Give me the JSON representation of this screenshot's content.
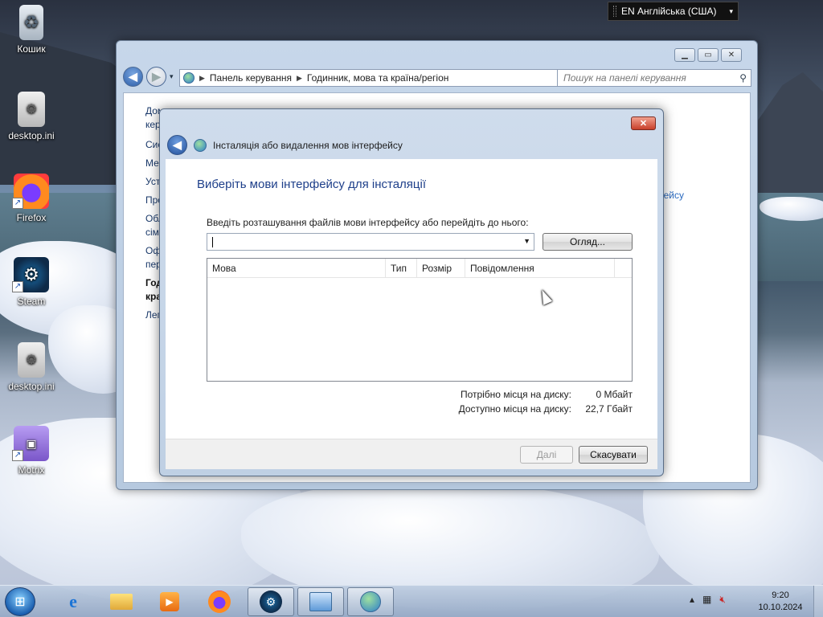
{
  "desktop": {
    "icons": [
      {
        "label": "Кошик",
        "icon": "recycle-bin-icon"
      },
      {
        "label": "desktop.ini",
        "icon": "settings-file-icon"
      },
      {
        "label": "Firefox",
        "icon": "firefox-icon"
      },
      {
        "label": "Steam",
        "icon": "steam-icon"
      },
      {
        "label": "desktop.ini",
        "icon": "settings-file-icon"
      },
      {
        "label": "Motrix",
        "icon": "motrix-icon"
      }
    ]
  },
  "langbar": {
    "label": "EN Англійська (США)"
  },
  "control_panel": {
    "breadcrumb": [
      "Панель керування",
      "Годинник, мова та країна/регіон"
    ],
    "search_placeholder": "Пошук на панелі керування",
    "sidebar_fragments": [
      "Дом",
      "кер",
      "Сис",
      "Мен",
      "Уст",
      "Про",
      "Обл",
      "сім",
      "Оф",
      "пер",
      "Год",
      "кра",
      "Лег"
    ],
    "right_fragment": "фейсу"
  },
  "dialog": {
    "window_title": "Інсталяція або видалення мов інтерфейсу",
    "heading": "Виберіть мови інтерфейсу для інсталяції",
    "location_prompt": "Введіть розташування файлів мови інтерфейсу або перейдіть до нього:",
    "location_value": "",
    "browse_button": "Огляд...",
    "columns": [
      "Мова",
      "Тип",
      "Розмір",
      "Повідомлення"
    ],
    "rows": [],
    "disk_required_label": "Потрібно місця на диску:",
    "disk_required_value": "0 Мбайт",
    "disk_available_label": "Доступно місця на диску:",
    "disk_available_value": "22,7 Гбайт",
    "next_button": "Далі",
    "cancel_button": "Скасувати"
  },
  "taskbar": {
    "items": [
      "internet-explorer-icon",
      "file-explorer-icon",
      "media-player-icon",
      "firefox-icon",
      "steam-icon",
      "control-panel-icon",
      "region-language-icon"
    ],
    "active_items": [
      "steam-icon",
      "control-panel-icon",
      "region-language-icon"
    ],
    "clock_time": "9:20",
    "clock_date": "10.10.2024"
  }
}
